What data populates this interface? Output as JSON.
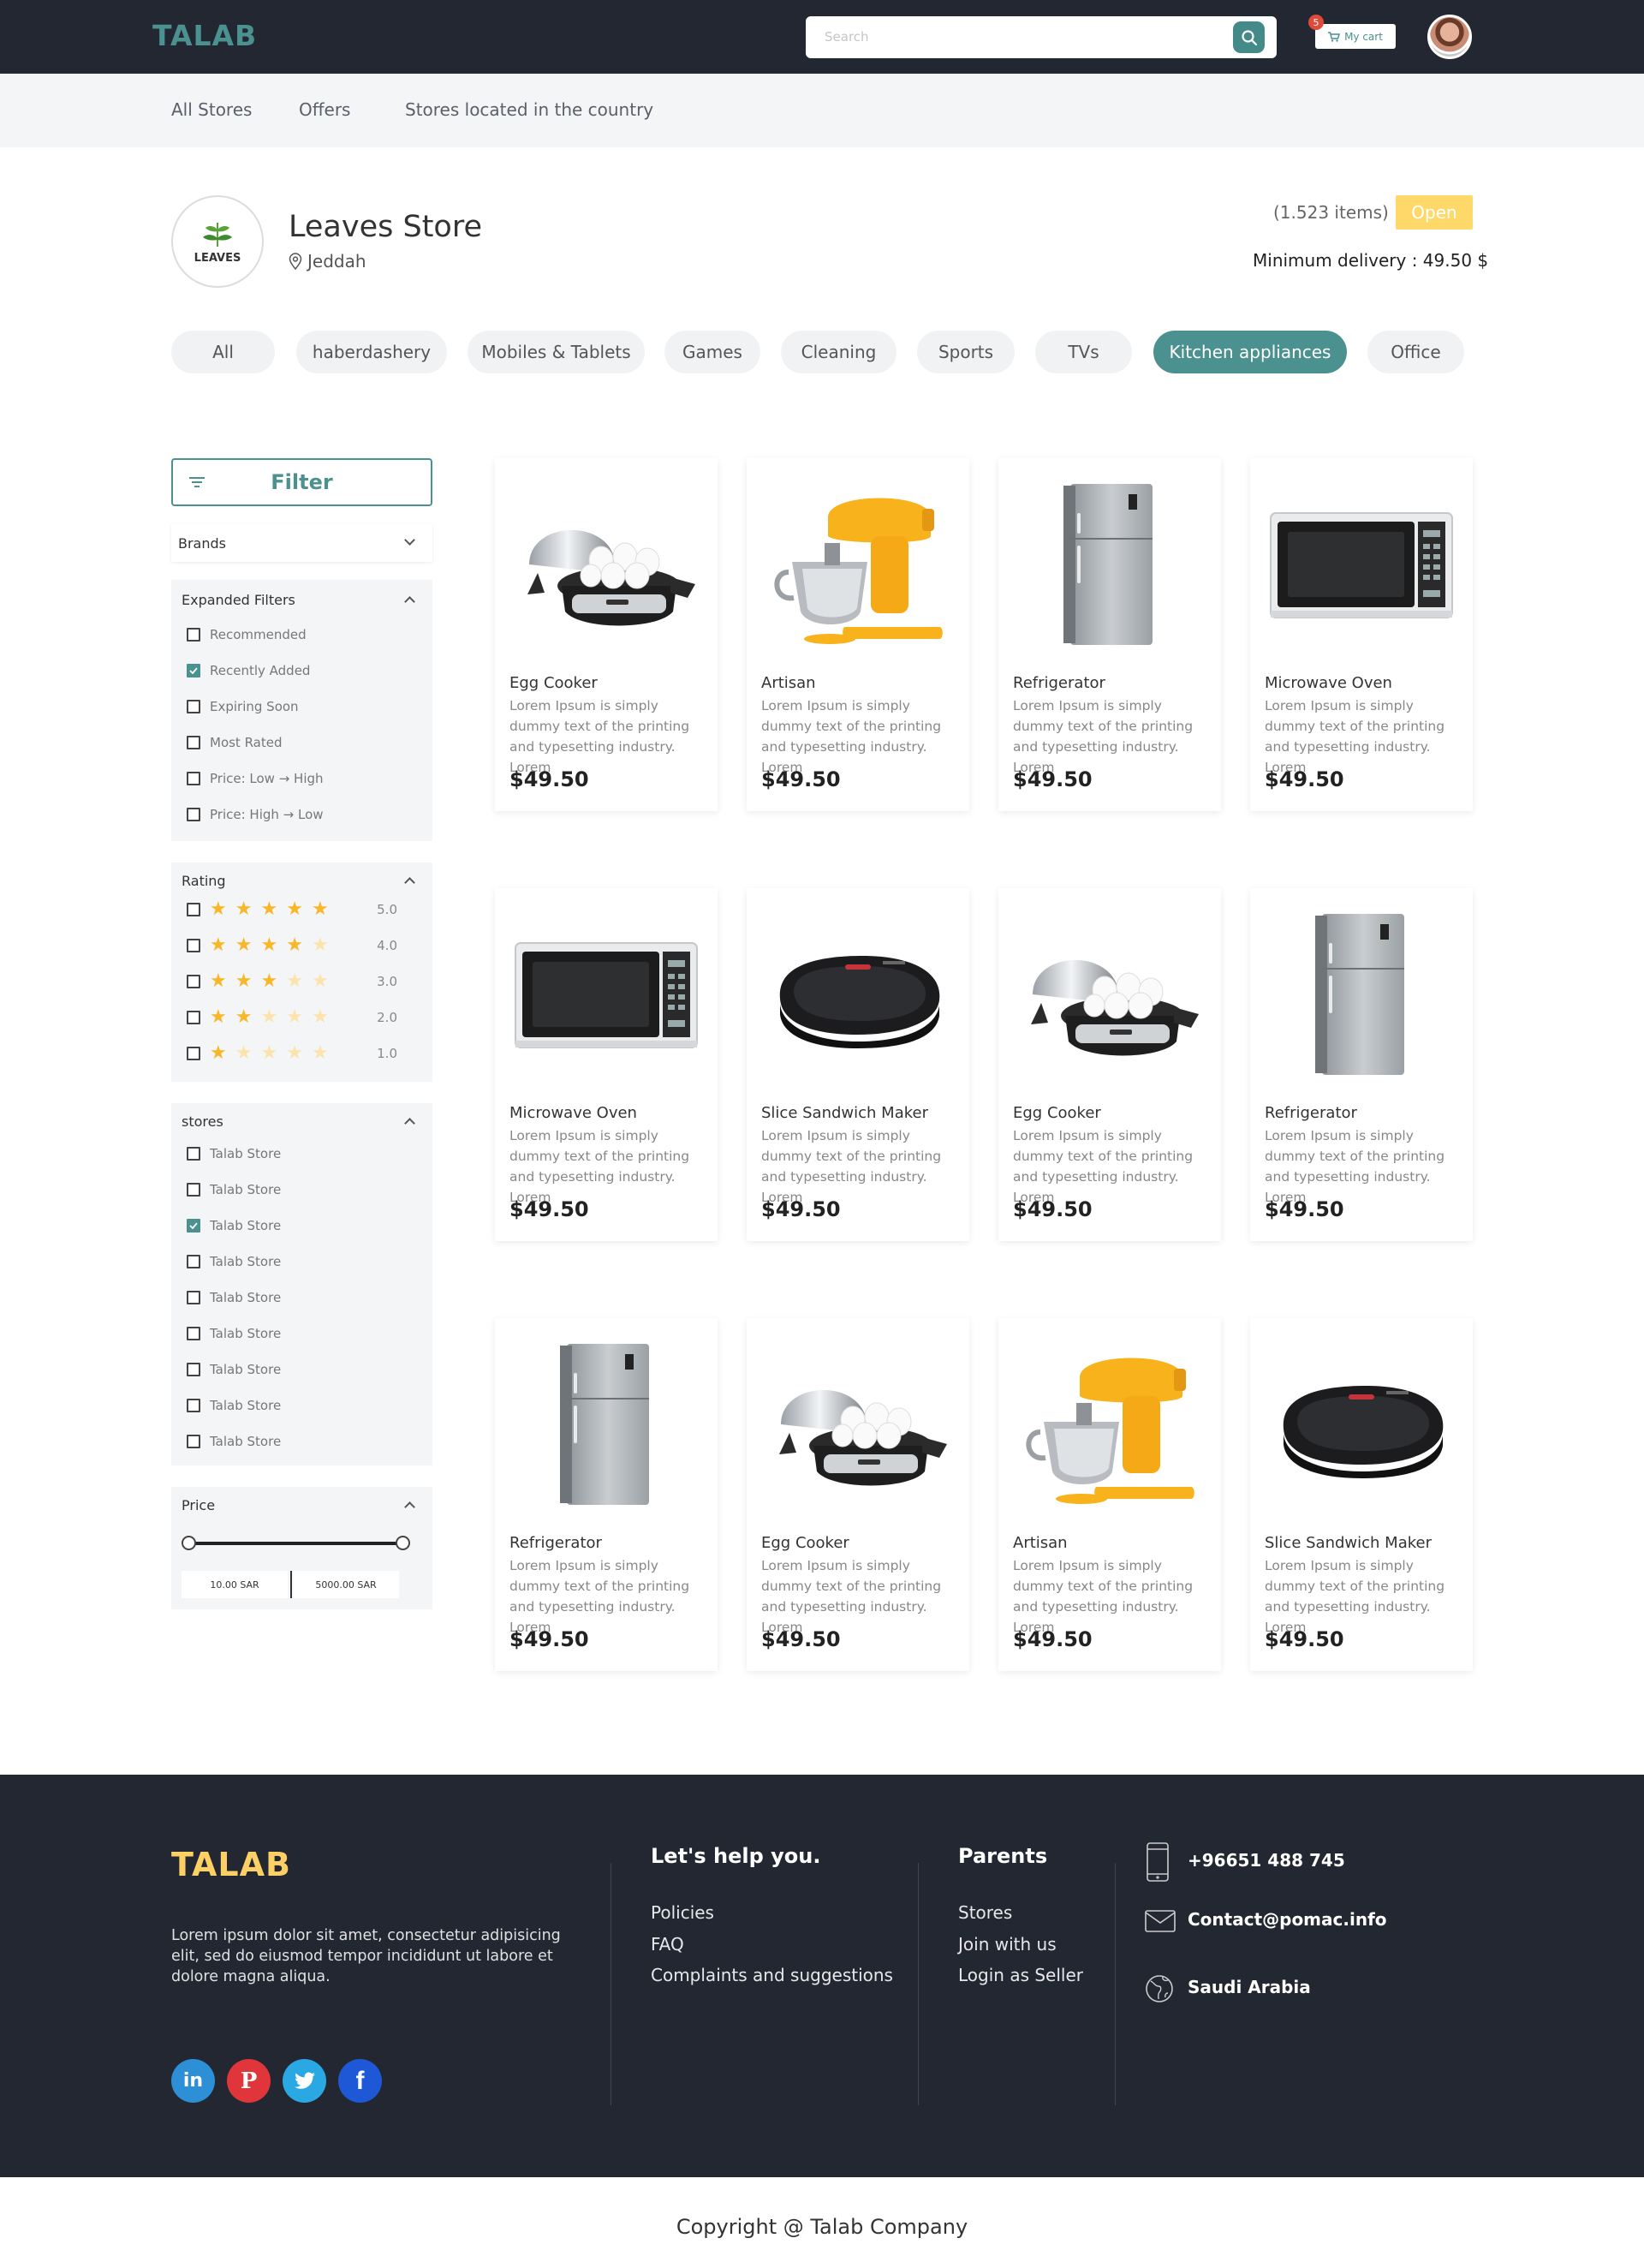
{
  "header": {
    "logo": "TALAB",
    "search_placeholder": "Search",
    "cart_label": "My cart",
    "cart_count": "5"
  },
  "subnav": [
    "All Stores",
    "Offers",
    "Stores located in the country"
  ],
  "store": {
    "name": "Leaves Store",
    "logo_text": "LEAVES",
    "location": "Jeddah",
    "items": "(1.523 items)",
    "status": "Open",
    "min_delivery": "Minimum delivery : 49.50 $"
  },
  "categories": [
    "All",
    "haberdashery",
    "Mobiles & Tablets",
    "Games",
    "Cleaning",
    "Sports",
    "TVs",
    "Kitchen appliances",
    "Office"
  ],
  "active_category": "Kitchen appliances",
  "sidebar": {
    "filter_label": "Filter",
    "brands_label": "Brands",
    "expanded": {
      "title": "Expanded Filters",
      "options": [
        {
          "label": "Recommended",
          "checked": false
        },
        {
          "label": "Recently Added",
          "checked": true
        },
        {
          "label": "Expiring Soon",
          "checked": false
        },
        {
          "label": "Most Rated",
          "checked": false
        },
        {
          "label": "Price: Low → High",
          "checked": false
        },
        {
          "label": "Price: High → Low",
          "checked": false
        }
      ]
    },
    "rating": {
      "title": "Rating",
      "options": [
        {
          "stars": 5,
          "value": "5.0"
        },
        {
          "stars": 4,
          "value": "4.0"
        },
        {
          "stars": 3,
          "value": "3.0"
        },
        {
          "stars": 2,
          "value": "2.0"
        },
        {
          "stars": 1,
          "value": "1.0"
        }
      ]
    },
    "stores": {
      "title": "stores",
      "options": [
        {
          "label": "Talab Store",
          "checked": false
        },
        {
          "label": "Talab Store",
          "checked": false
        },
        {
          "label": "Talab Store",
          "checked": true
        },
        {
          "label": "Talab Store",
          "checked": false
        },
        {
          "label": "Talab Store",
          "checked": false
        },
        {
          "label": "Talab Store",
          "checked": false
        },
        {
          "label": "Talab Store",
          "checked": false
        },
        {
          "label": "Talab Store",
          "checked": false
        },
        {
          "label": "Talab Store",
          "checked": false
        }
      ]
    },
    "price": {
      "title": "Price",
      "min": "10.00 SAR",
      "max": "5000.00 SAR"
    }
  },
  "products": [
    {
      "name": "Egg Cooker",
      "type": "egg",
      "desc": "Lorem Ipsum is simply dummy text of the printing and typesetting industry. Lorem",
      "price": "$49.50"
    },
    {
      "name": "Artisan",
      "type": "mixer",
      "desc": "Lorem Ipsum is simply dummy text of the printing and typesetting industry. Lorem",
      "price": "$49.50"
    },
    {
      "name": "Refrigerator",
      "type": "fridge",
      "desc": "Lorem Ipsum is simply dummy text of the printing and typesetting industry. Lorem",
      "price": "$49.50"
    },
    {
      "name": "Microwave Oven",
      "type": "microwave",
      "desc": "Lorem Ipsum is simply dummy text of the printing and typesetting industry. Lorem",
      "price": "$49.50"
    },
    {
      "name": "Microwave Oven",
      "type": "microwave",
      "desc": "Lorem Ipsum is simply dummy text of the printing and typesetting industry. Lorem",
      "price": "$49.50"
    },
    {
      "name": "Slice Sandwich Maker",
      "type": "sandwich",
      "desc": "Lorem Ipsum is simply dummy text of the printing and typesetting industry. Lorem",
      "price": "$49.50"
    },
    {
      "name": "Egg Cooker",
      "type": "egg",
      "desc": "Lorem Ipsum is simply dummy text of the printing and typesetting industry. Lorem",
      "price": "$49.50"
    },
    {
      "name": "Refrigerator",
      "type": "fridge",
      "desc": "Lorem Ipsum is simply dummy text of the printing and typesetting industry. Lorem",
      "price": "$49.50"
    },
    {
      "name": "Refrigerator",
      "type": "fridge",
      "desc": "Lorem Ipsum is simply dummy text of the printing and typesetting industry. Lorem",
      "price": "$49.50"
    },
    {
      "name": "Egg Cooker",
      "type": "egg",
      "desc": "Lorem Ipsum is simply dummy text of the printing and typesetting industry. Lorem",
      "price": "$49.50"
    },
    {
      "name": "Artisan",
      "type": "mixer",
      "desc": "Lorem Ipsum is simply dummy text of the printing and typesetting industry. Lorem",
      "price": "$49.50"
    },
    {
      "name": "Slice Sandwich Maker",
      "type": "sandwich",
      "desc": "Lorem Ipsum is simply dummy text of the printing and typesetting industry. Lorem",
      "price": "$49.50"
    }
  ],
  "footer": {
    "logo": "TALAB",
    "description": "Lorem ipsum dolor sit amet, consectetur adipisicing elit, sed do eiusmod tempor incididunt ut labore et dolore magna aliqua.",
    "help_title": "Let's help you.",
    "help_links": [
      "Policies",
      "FAQ",
      "Complaints and suggestions"
    ],
    "parents_title": "Parents",
    "parents_links": [
      "Stores",
      "Join with us",
      "Login as Seller"
    ],
    "phone": "+96651 488 745",
    "email": "Contact@pomac.info",
    "country": "Saudi Arabia",
    "social": [
      "linkedin-icon",
      "pinterest-icon",
      "twitter-icon",
      "facebook-icon"
    ]
  },
  "copyright": "Copyright @ Talab Company",
  "colors": {
    "brand": "#4b918f",
    "dark": "#222732",
    "accent": "#fed96a",
    "star": "#f8b628"
  }
}
